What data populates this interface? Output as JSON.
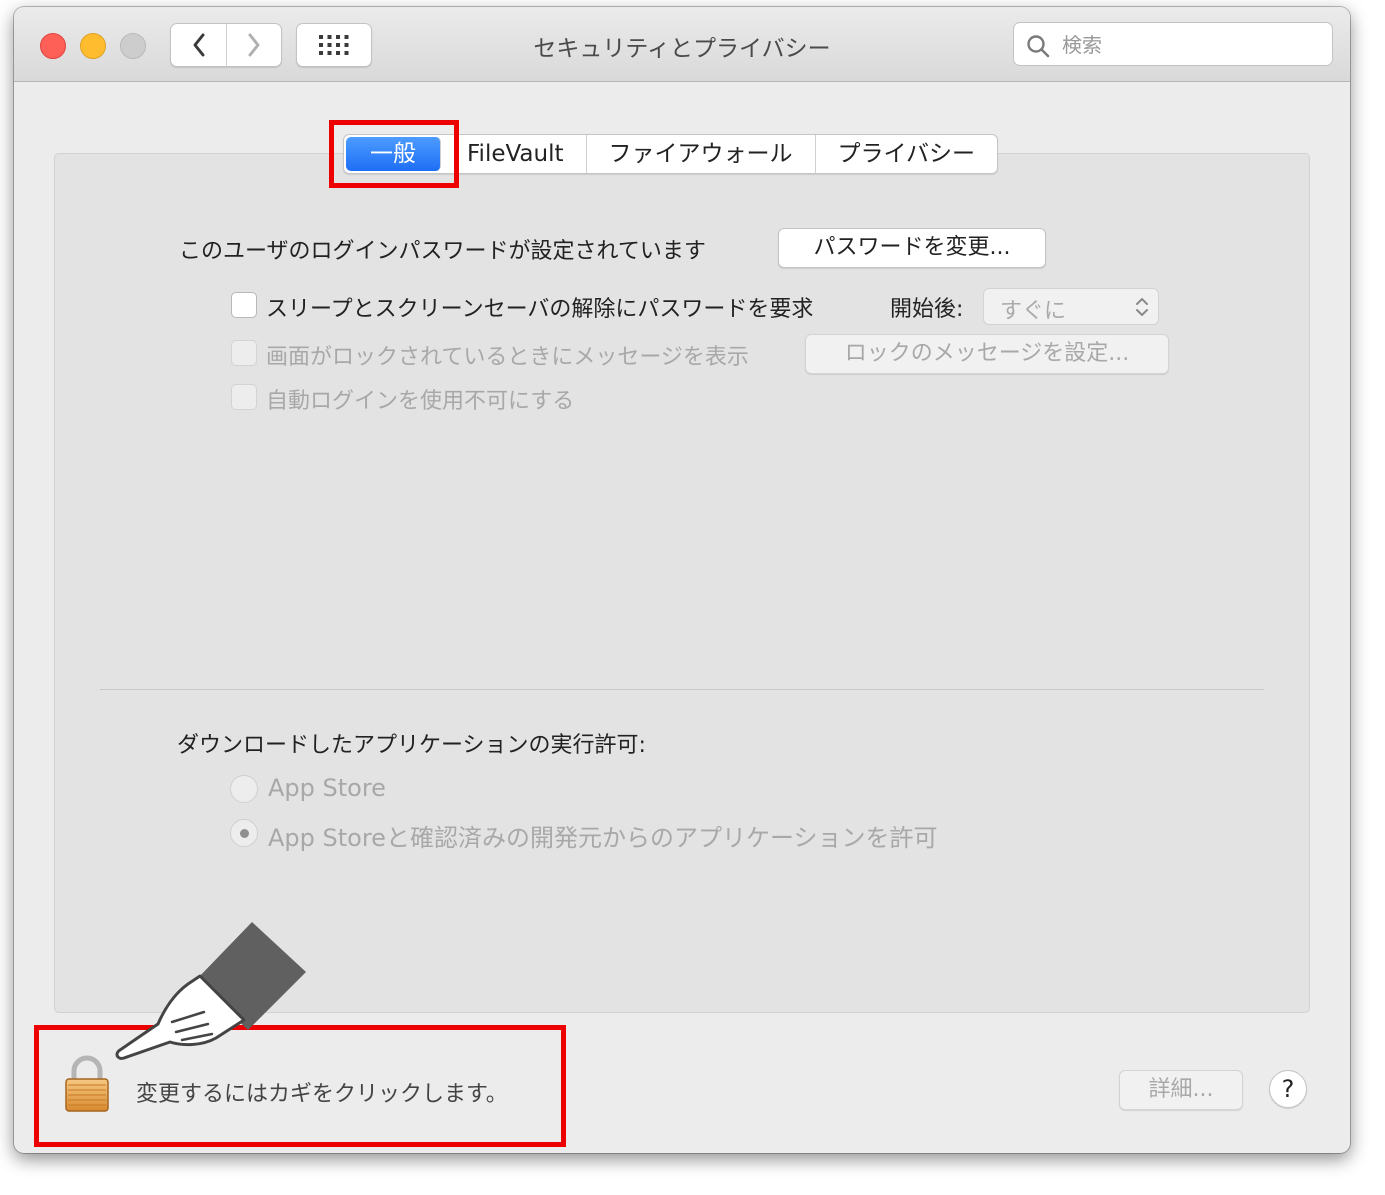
{
  "window": {
    "title": "セキュリティとプライバシー",
    "search_placeholder": "検索"
  },
  "tabs": [
    {
      "label": "一般",
      "active": true
    },
    {
      "label": "FileVault",
      "active": false
    },
    {
      "label": "ファイアウォール",
      "active": false
    },
    {
      "label": "プライバシー",
      "active": false
    }
  ],
  "general": {
    "password_status": "このユーザのログインパスワードが設定されています",
    "change_password_button": "パスワードを変更...",
    "require_password_label": "スリープとスクリーンセーバの解除にパスワードを要求",
    "after_label": "開始後:",
    "after_value": "すぐに",
    "lock_message_label": "画面がロックされているときにメッセージを表示",
    "set_lock_message_button": "ロックのメッセージを設定...",
    "disable_autologin_label": "自動ログインを使用不可にする",
    "download_heading": "ダウンロードしたアプリケーションの実行許可:",
    "radio_app_store": "App Store",
    "radio_app_store_devs": "App Storeと確認済みの開発元からのアプリケーションを許可"
  },
  "footer": {
    "lock_text": "変更するにはカギをクリックします。",
    "advanced_button": "詳細...",
    "help_button": "?"
  },
  "colors": {
    "highlight": "#ec0000",
    "active_tab": "#1e6ef5"
  },
  "icons": [
    "back-chevron-icon",
    "forward-chevron-icon",
    "grid-icon",
    "search-icon",
    "lock-icon",
    "pointing-hand-icon",
    "updown-chevron-icon"
  ]
}
